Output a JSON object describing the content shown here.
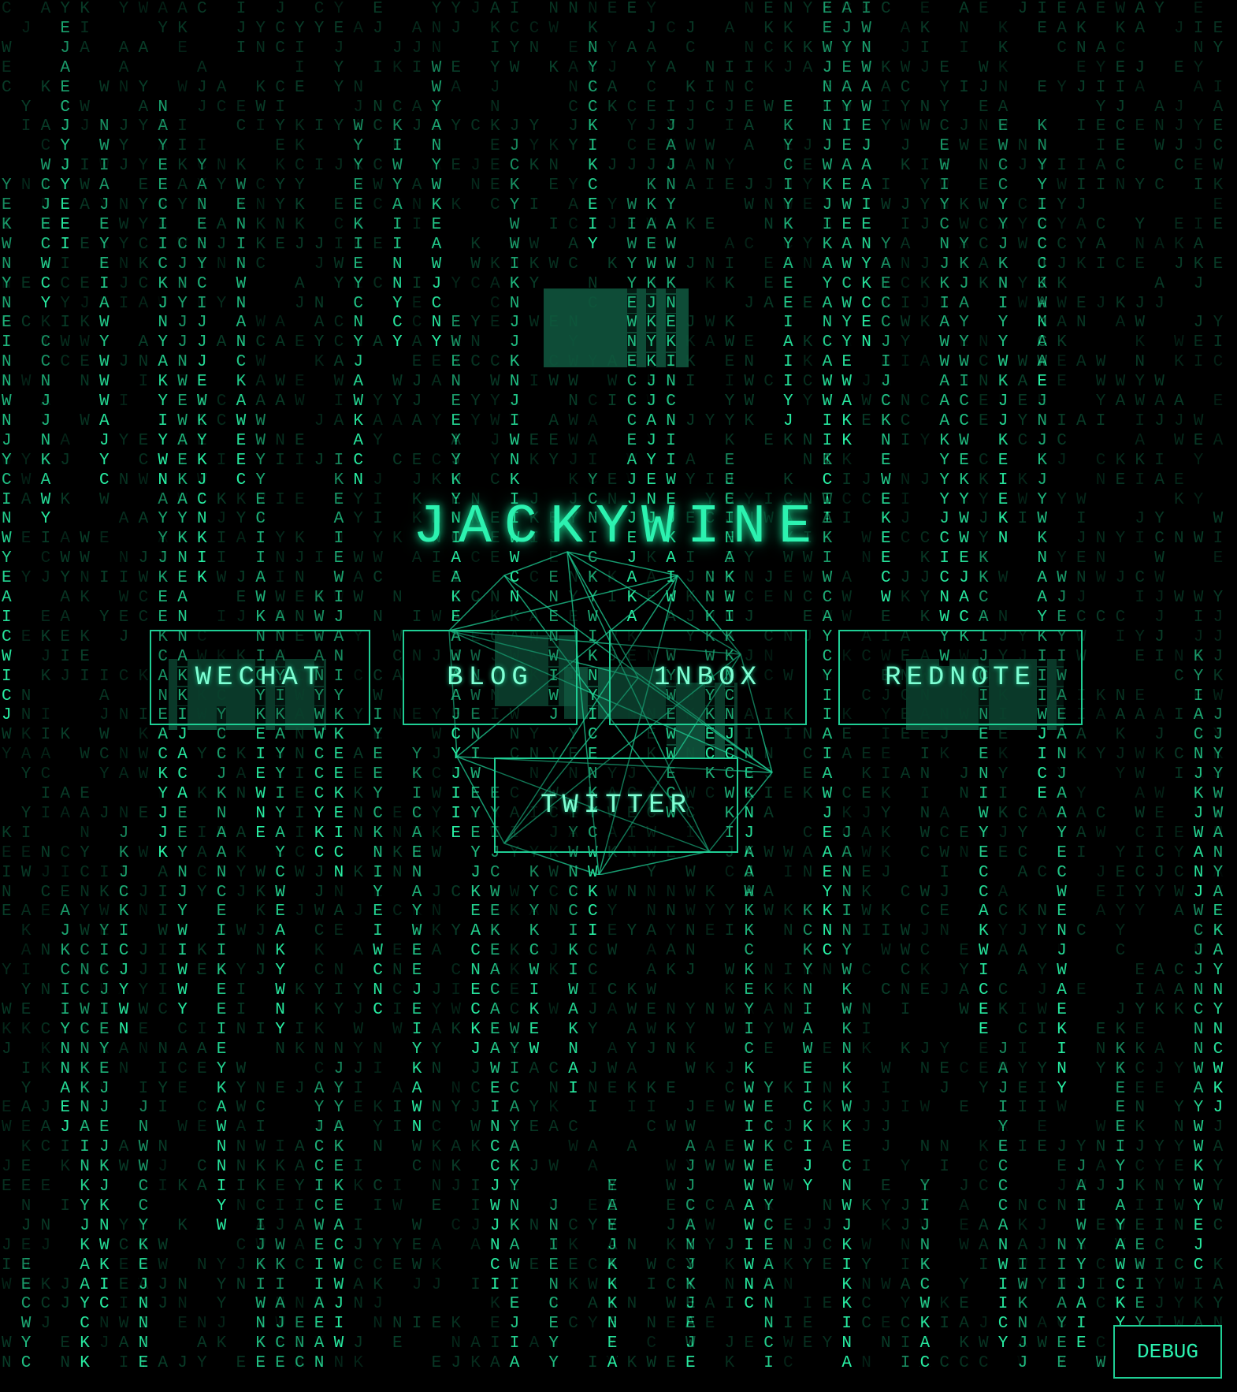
{
  "site": {
    "title": "JACKYWINE"
  },
  "nav": {
    "wechat_label": "WECHAT",
    "blog_label": "BLOG",
    "inbox_label": "1NBOX",
    "rednote_label": "REDNOTE",
    "twitter_label": "TWITTER"
  },
  "debug": {
    "label": "DEBUG"
  },
  "background": {
    "effect": "matrix-rain",
    "glyphs": "JACKYWINE",
    "color_bright": "#2af5a8",
    "color_dim": "#0d5a3c"
  },
  "colors": {
    "accent": "#2cf2b0",
    "border": "#1fcf95",
    "background": "#000000"
  }
}
